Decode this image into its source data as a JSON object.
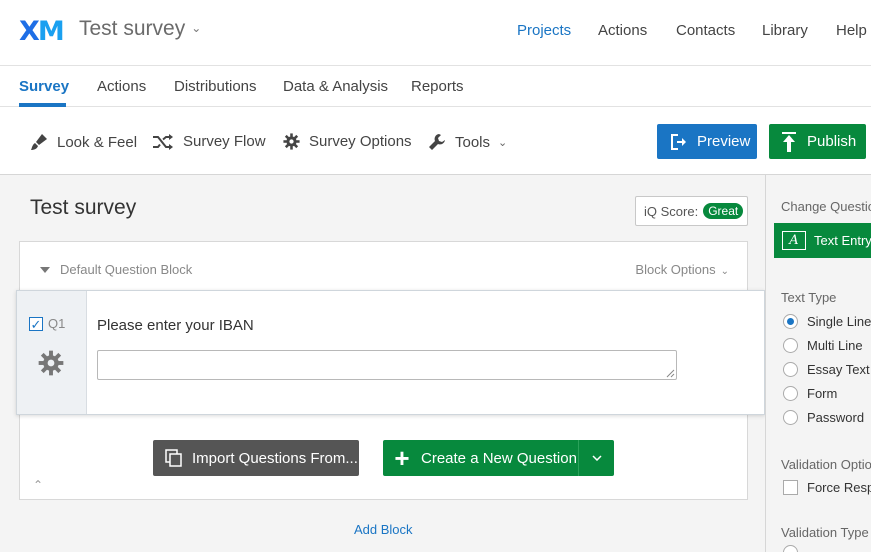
{
  "header": {
    "logo": "XM",
    "survey_title": "Test survey",
    "nav": [
      "Projects",
      "Actions",
      "Contacts",
      "Library",
      "Help"
    ],
    "active_nav": "Projects"
  },
  "tabs": [
    "Survey",
    "Actions",
    "Distributions",
    "Data & Analysis",
    "Reports"
  ],
  "toolbar": {
    "look_feel": "Look & Feel",
    "survey_flow": "Survey Flow",
    "survey_options": "Survey Options",
    "tools": "Tools",
    "preview": "Preview",
    "publish": "Publish"
  },
  "editor": {
    "heading": "Test survey",
    "iq_label": "iQ Score:",
    "iq_value": "Great",
    "block_title": "Default Question Block",
    "block_options": "Block Options",
    "question": {
      "id": "Q1",
      "checked": true,
      "text": "Please enter your IBAN",
      "value": ""
    },
    "import_button": "Import Questions From...",
    "create_button": "Create a New Question",
    "add_block": "Add Block"
  },
  "right_panel": {
    "change_question": "Change Questio",
    "type_button": "Text Entry",
    "text_type_label": "Text Type",
    "text_types": [
      "Single Line",
      "Multi Line",
      "Essay Text I",
      "Form",
      "Password"
    ],
    "selected_text_type": "Single Line",
    "validation_options_label": "Validation Optio",
    "force_response": "Force Respo",
    "validation_type_label": "Validation Type"
  },
  "colors": {
    "accent_blue": "#1a75c4",
    "publish_green": "#07893d",
    "import_gray": "#555555"
  }
}
